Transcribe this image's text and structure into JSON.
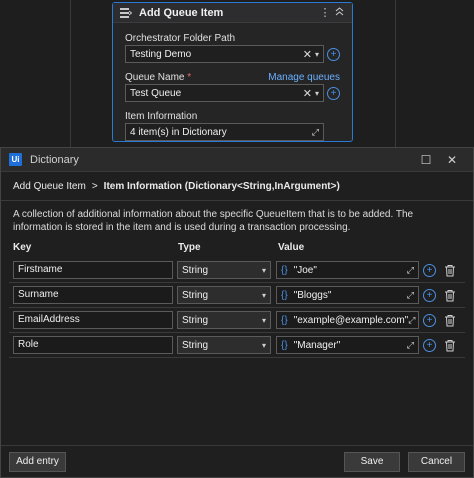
{
  "activity": {
    "title": "Add Queue Item",
    "folder_label": "Orchestrator Folder Path",
    "folder_value": "Testing Demo",
    "queue_label": "Queue Name",
    "queue_required_mark": "*",
    "manage_link": "Manage queues",
    "queue_value": "Test Queue",
    "item_info_label": "Item Information",
    "item_info_value": "4 item(s) in Dictionary"
  },
  "dialog": {
    "title": "Dictionary",
    "logo_text": "Ui",
    "breadcrumb": {
      "parent": "Add Queue Item",
      "separator": ">",
      "current": "Item Information (Dictionary<String,InArgument>)"
    },
    "description": "A collection of additional information about the specific QueueItem that is to be added. The information is stored in the item and is used during a transaction processing.",
    "columns": {
      "key": "Key",
      "type": "Type",
      "value": "Value"
    },
    "entries": [
      {
        "key": "Firstname",
        "type": "String",
        "value": "\"Joe\""
      },
      {
        "key": "Surname",
        "type": "String",
        "value": "\"Bloggs\""
      },
      {
        "key": "EmailAddress",
        "type": "String",
        "value": "\"example@example.com\""
      },
      {
        "key": "Role",
        "type": "String",
        "value": "\"Manager\""
      }
    ],
    "footer": {
      "add_entry": "Add entry",
      "save": "Save",
      "cancel": "Cancel"
    }
  },
  "icons": {
    "brace": "{}",
    "close": "✕",
    "chevron": "▾",
    "plus": "+",
    "expand": "⤢",
    "more": "⋮",
    "collapse": "⌃",
    "maximize": "☐"
  },
  "colors": {
    "accent": "#2a7ad4",
    "link": "#6ab0ff",
    "background": "#1e1e1e"
  }
}
